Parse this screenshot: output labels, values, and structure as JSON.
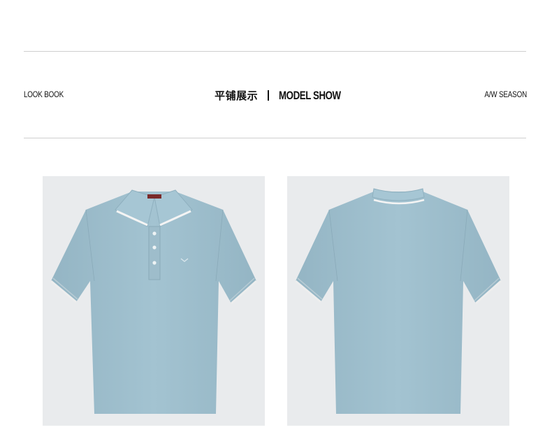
{
  "header": {
    "left_label": "LOOK BOOK",
    "title_cn": "平铺展示",
    "title_en": "MODEL SHOW",
    "right_label": "A/W SEASON"
  },
  "products": [
    {
      "view": "front",
      "shirt_color": "#9fbfcd",
      "collar_stripe_color": "#f2f2f2"
    },
    {
      "view": "back",
      "shirt_color": "#9fbfcd",
      "collar_stripe_color": "#f2f2f2"
    }
  ],
  "colors": {
    "photo_background": "#e9ebed",
    "rule_line": "#cfcfcf",
    "text": "#111111"
  }
}
